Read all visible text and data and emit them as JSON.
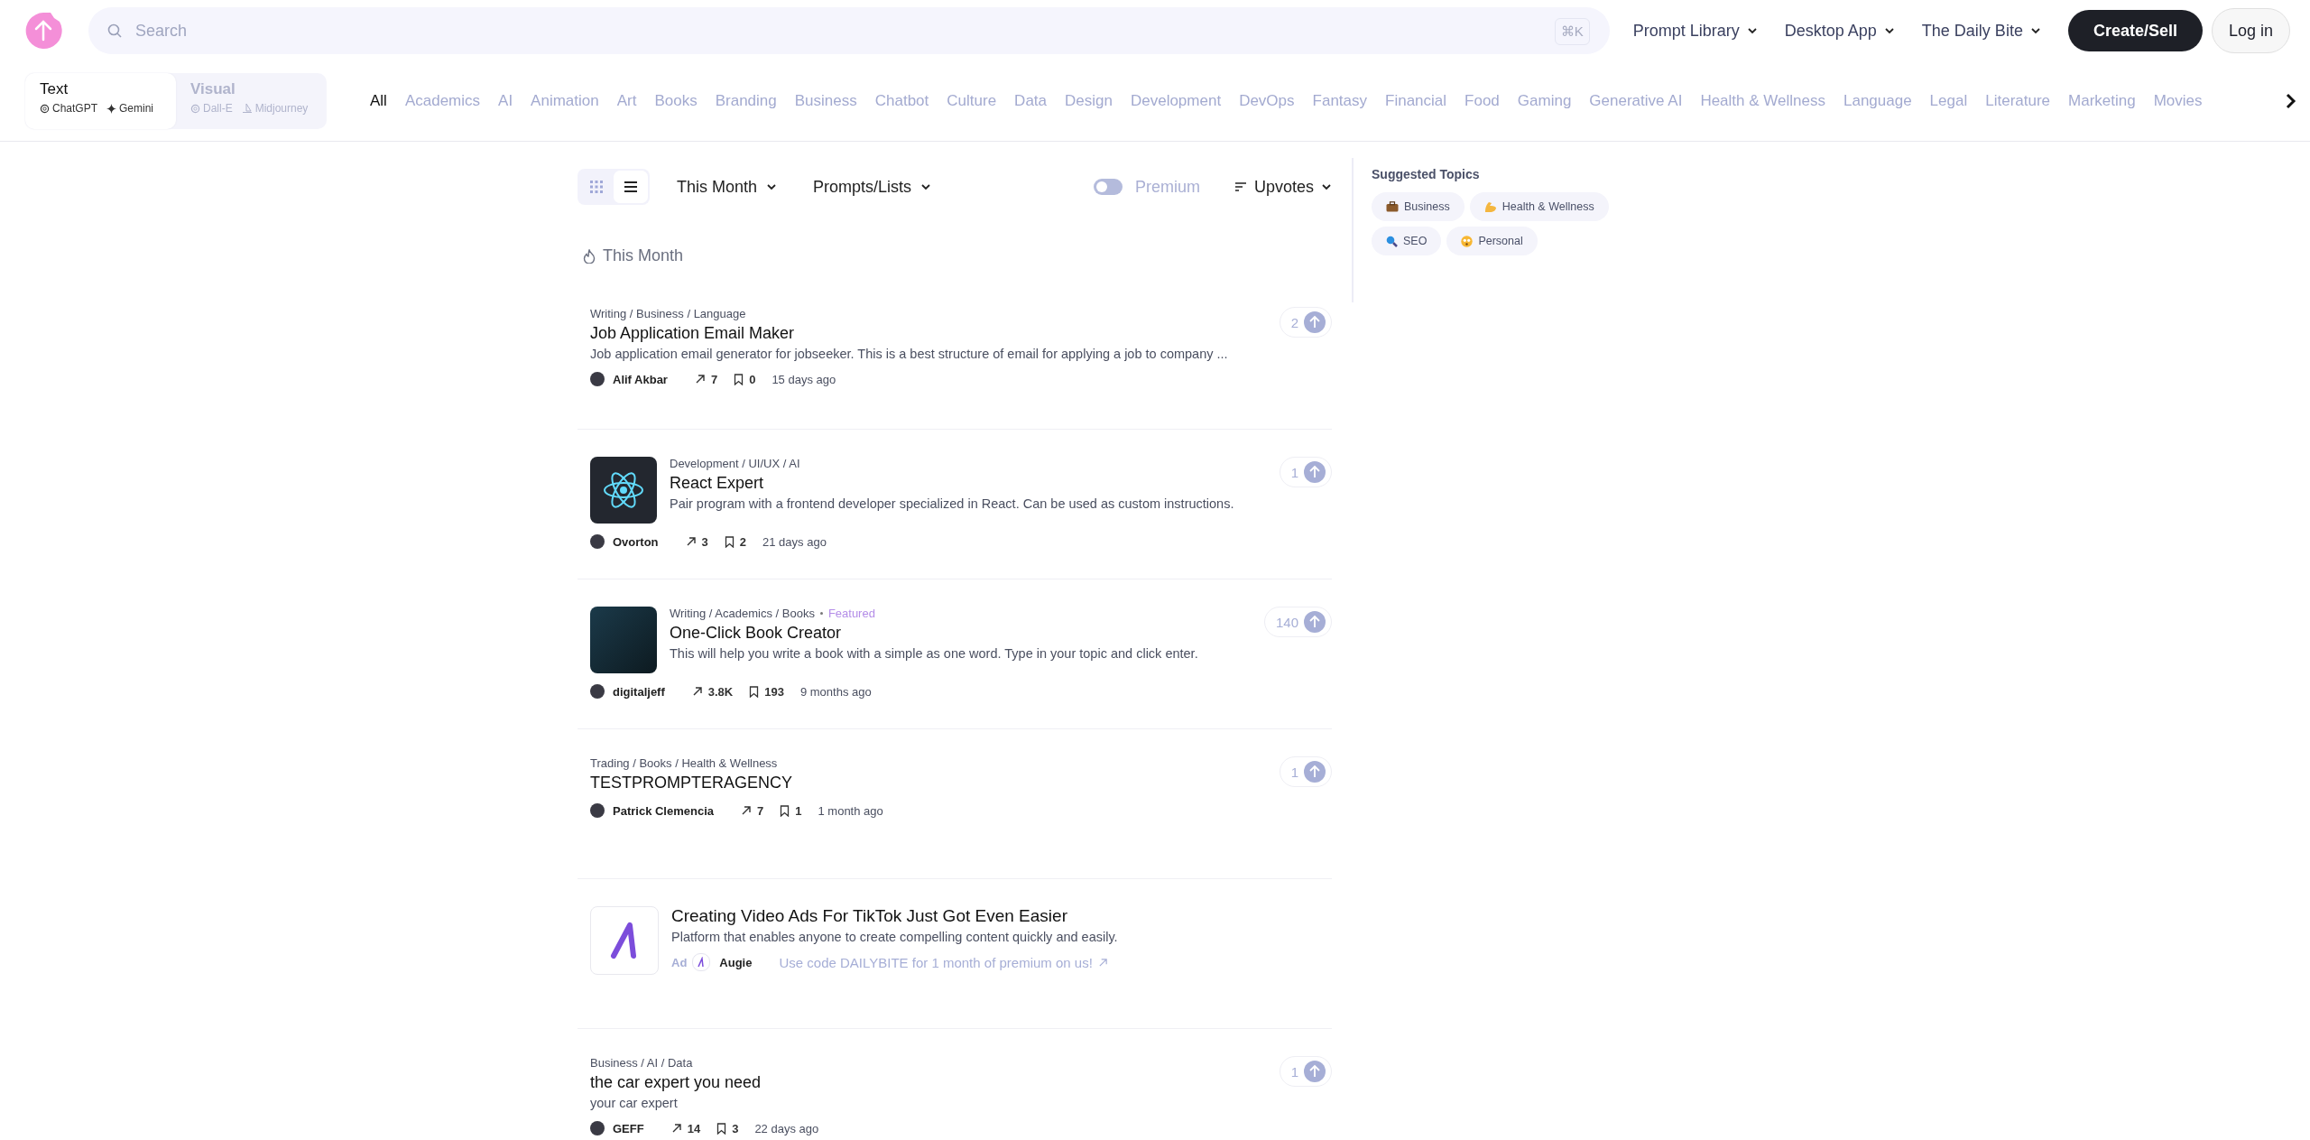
{
  "header": {
    "search": {
      "placeholder": "Search",
      "shortcut": "⌘K"
    },
    "nav": [
      "Prompt Library",
      "Desktop App",
      "The Daily Bite"
    ],
    "create_button": "Create/Sell",
    "login_button": "Log in"
  },
  "modes": [
    {
      "label": "Text",
      "selected": true,
      "models": [
        "ChatGPT",
        "Gemini"
      ]
    },
    {
      "label": "Visual",
      "selected": false,
      "models": [
        "Dall-E",
        "Midjourney"
      ]
    }
  ],
  "categories": [
    {
      "label": "All",
      "selected": true
    },
    {
      "label": "Academics",
      "selected": false
    },
    {
      "label": "AI",
      "selected": false
    },
    {
      "label": "Animation",
      "selected": false
    },
    {
      "label": "Art",
      "selected": false
    },
    {
      "label": "Books",
      "selected": false
    },
    {
      "label": "Branding",
      "selected": false
    },
    {
      "label": "Business",
      "selected": false
    },
    {
      "label": "Chatbot",
      "selected": false
    },
    {
      "label": "Culture",
      "selected": false
    },
    {
      "label": "Data",
      "selected": false
    },
    {
      "label": "Design",
      "selected": false
    },
    {
      "label": "Development",
      "selected": false
    },
    {
      "label": "DevOps",
      "selected": false
    },
    {
      "label": "Fantasy",
      "selected": false
    },
    {
      "label": "Financial",
      "selected": false
    },
    {
      "label": "Food",
      "selected": false
    },
    {
      "label": "Gaming",
      "selected": false
    },
    {
      "label": "Generative AI",
      "selected": false
    },
    {
      "label": "Health & Wellness",
      "selected": false
    },
    {
      "label": "Language",
      "selected": false
    },
    {
      "label": "Legal",
      "selected": false
    },
    {
      "label": "Literature",
      "selected": false
    },
    {
      "label": "Marketing",
      "selected": false
    },
    {
      "label": "Movies",
      "selected": false
    }
  ],
  "toolbar": {
    "views": [
      {
        "kind": "grid",
        "selected": false
      },
      {
        "kind": "list",
        "selected": true
      }
    ],
    "period": "This Month",
    "type": "Prompts/Lists",
    "premium": {
      "label": "Premium",
      "on": false
    },
    "sort": "Upvotes"
  },
  "section_title": "This Month",
  "posts": [
    {
      "kind": "text",
      "path": "Writing / Business / Language",
      "title": "Job Application Email Maker",
      "description": "Job application email generator for jobseeker. This is a best structure of email for applying a job to company ...",
      "author": "Alif Akbar",
      "shares": "7",
      "saves": "0",
      "time": "15 days ago",
      "upvotes": "2"
    },
    {
      "kind": "logo",
      "path": "Development / UI/UX / AI",
      "title": "React Expert",
      "description": "Pair program with a frontend developer specialized in React. Can be used as custom instructions.",
      "author": "Ovorton",
      "shares": "3",
      "saves": "2",
      "time": "21 days ago",
      "upvotes": "1"
    },
    {
      "kind": "photo",
      "path": "Writing / Academics / Books",
      "badge": "Featured",
      "title": "One-Click Book Creator",
      "description": "This will help you write a book with a simple as one word. Type in your topic and click enter.",
      "author": "digitaljeff",
      "shares": "3.8K",
      "saves": "193",
      "time": "9 months ago",
      "upvotes": "140"
    },
    {
      "kind": "text",
      "path": "Trading / Books / Health & Wellness",
      "title": "TESTPROMPTERAGENCY",
      "author": "Patrick Clemencia",
      "shares": "7",
      "saves": "1",
      "time": "1 month ago",
      "upvotes": "1"
    },
    {
      "kind": "ad",
      "title": "Creating Video Ads For TikTok Just Got Even Easier",
      "description": "Platform that enables anyone to create compelling content quickly and easily.",
      "ad_label": "Ad",
      "advertiser": "Augie",
      "promo": "Use code DAILYBITE for 1 month of premium on us!"
    },
    {
      "kind": "text",
      "path": "Business / AI / Data",
      "title": "the car expert you need",
      "description": "your car expert",
      "author": "GEFF",
      "shares": "14",
      "saves": "3",
      "time": "22 days ago",
      "upvotes": "1"
    }
  ],
  "suggested": {
    "title": "Suggested Topics",
    "topics": [
      "Business",
      "Health & Wellness",
      "SEO",
      "Personal"
    ]
  }
}
